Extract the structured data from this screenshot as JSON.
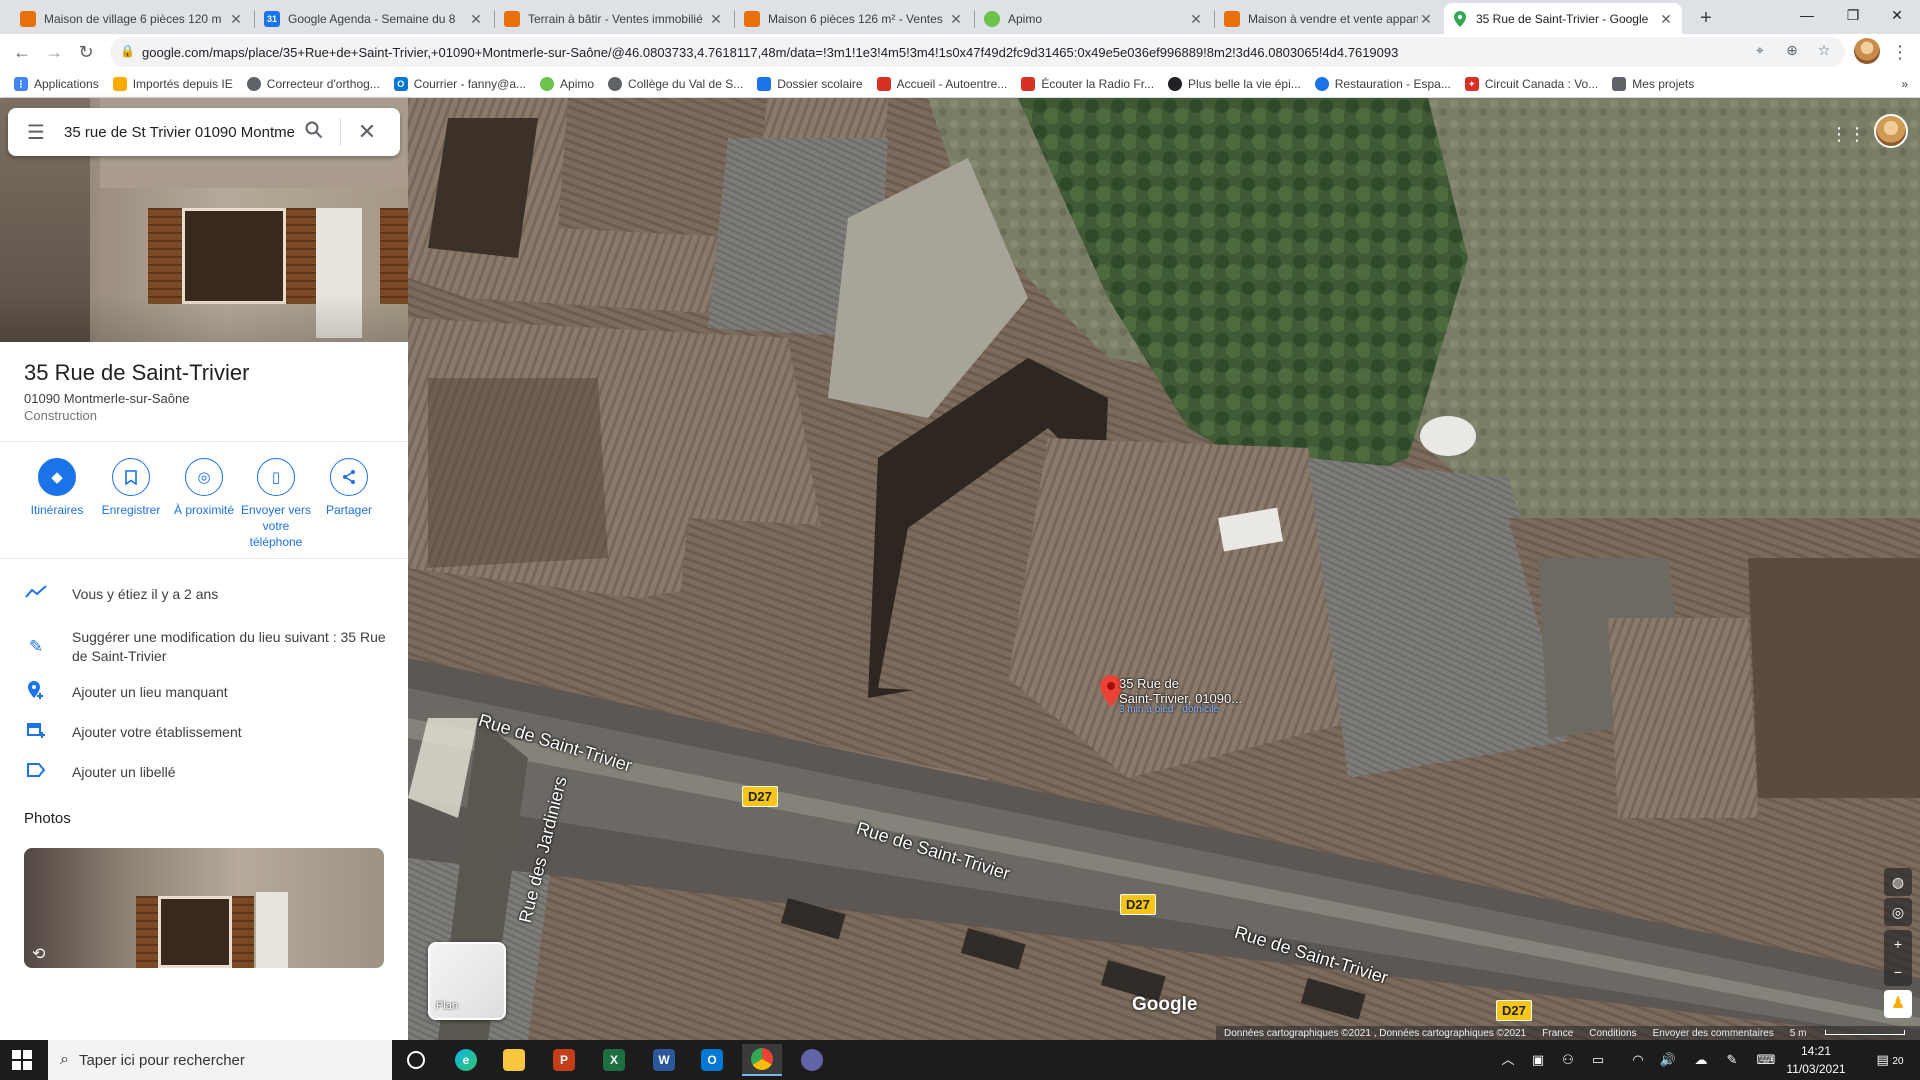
{
  "browser": {
    "tabs": [
      {
        "title": "Maison de village 6 pièces 120 m",
        "icon_color": "#e8710a",
        "active": false
      },
      {
        "title": "Google Agenda - Semaine du 8 ",
        "icon_color": "#1a73e8",
        "active": false
      },
      {
        "title": "Terrain à bâtir - Ventes immobilié",
        "icon_color": "#e8710a",
        "active": false
      },
      {
        "title": "Maison 6 pièces 126 m² - Ventes",
        "icon_color": "#e8710a",
        "active": false
      },
      {
        "title": "Apimo",
        "icon_color": "#6cc24a",
        "active": false
      },
      {
        "title": "Maison à vendre et vente appart",
        "icon_color": "#e8710a",
        "active": false
      },
      {
        "title": "35 Rue de Saint-Trivier - Google",
        "icon_color": "#34a853",
        "active": true
      }
    ],
    "new_tab_label": "+",
    "url": "google.com/maps/place/35+Rue+de+Saint-Trivier,+01090+Montmerle-sur-Saône/@46.0803733,4.7618117,48m/data=!3m1!1e3!4m5!3m4!1s0x47f49d2fc9d31465:0x49e5e036ef996889!8m2!3d46.0803065!4d4.7619093",
    "bookmarks": [
      {
        "label": "Applications",
        "icon_color": "#4285f4"
      },
      {
        "label": "Importés depuis IE",
        "icon_color": "#f9ab00"
      },
      {
        "label": "Correcteur d'orthog...",
        "icon_color": "#5f6368"
      },
      {
        "label": "Courrier - fanny@a...",
        "icon_color": "#0078d4"
      },
      {
        "label": "Apimo",
        "icon_color": "#6cc24a"
      },
      {
        "label": "Collège du Val de S...",
        "icon_color": "#5f6368"
      },
      {
        "label": "Dossier scolaire",
        "icon_color": "#1a73e8"
      },
      {
        "label": "Accueil - Autoentre...",
        "icon_color": "#d93025"
      },
      {
        "label": "Écouter la Radio Fr...",
        "icon_color": "#d93025"
      },
      {
        "label": "Plus belle la vie épi...",
        "icon_color": "#202124"
      },
      {
        "label": "Restauration - Espa...",
        "icon_color": "#1a73e8"
      },
      {
        "label": "Circuit Canada : Vo...",
        "icon_color": "#d93025"
      },
      {
        "label": "Mes projets",
        "icon_color": "#5f6368"
      }
    ],
    "more_bookmarks": "»"
  },
  "panel": {
    "search_value": "35 rue de St Trivier 01090 Montmerle",
    "title": "35 Rue de Saint-Trivier",
    "address": "01090 Montmerle-sur-Saône",
    "category": "Construction",
    "actions": [
      {
        "label": "Itinéraires",
        "icon": "directions-icon"
      },
      {
        "label": "Enregistrer",
        "icon": "bookmark-icon"
      },
      {
        "label": "À proximité",
        "icon": "nearby-icon"
      },
      {
        "label": "Envoyer vers votre téléphone",
        "icon": "send-to-phone-icon"
      },
      {
        "label": "Partager",
        "icon": "share-icon"
      }
    ],
    "rows": [
      {
        "label": "Vous y étiez il y a 2 ans",
        "icon": "timeline-icon"
      },
      {
        "label": "Suggérer une modification du lieu suivant : 35 Rue de Saint-Trivier",
        "icon": "edit-icon"
      },
      {
        "label": "Ajouter un lieu manquant",
        "icon": "add-place-icon"
      },
      {
        "label": "Ajouter votre établissement",
        "icon": "add-business-icon"
      },
      {
        "label": "Ajouter un libellé",
        "icon": "label-icon"
      }
    ],
    "photos_heading": "Photos"
  },
  "map": {
    "street_labels": [
      "Rue de Saint-Trivier",
      "Rue de Saint-Trivier",
      "Rue de Saint-Trivier",
      "Rue des Jardiniers"
    ],
    "road_badge": "D27",
    "pin_label_line1": "35 Rue de",
    "pin_label_line2": "Saint-Trivier, 01090...",
    "pin_sublabel": "3 min à pied - domicile",
    "layer_toggle": "Plan",
    "logo": "Google",
    "footer": {
      "attribution": "Données cartographiques ©2021 , Données cartographiques ©2021",
      "country": "France",
      "terms": "Conditions",
      "feedback": "Envoyer des commentaires",
      "scale": "5 m"
    }
  },
  "taskbar": {
    "search_placeholder": "Taper ici pour rechercher",
    "time": "14:21",
    "date": "11/03/2021",
    "notification_count": "20"
  }
}
